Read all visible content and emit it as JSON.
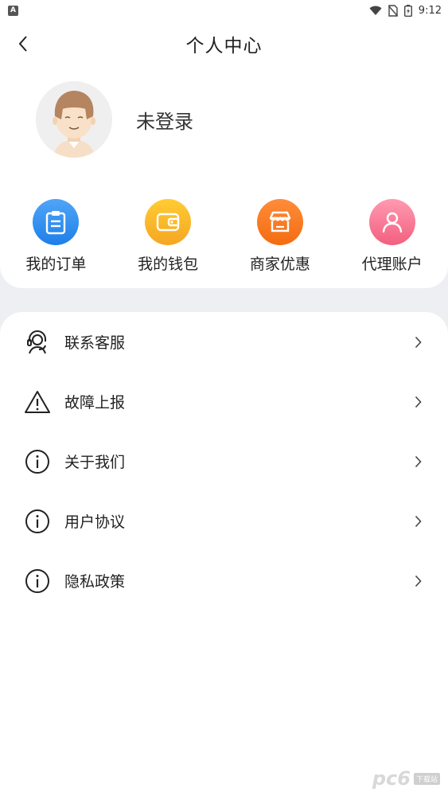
{
  "status_bar": {
    "app_badge": "A",
    "time": "9:12"
  },
  "header": {
    "title": "个人中心"
  },
  "profile": {
    "login_text": "未登录"
  },
  "quick_actions": [
    {
      "label": "我的订单",
      "icon": "clipboard-icon",
      "color": "#2e8cf0"
    },
    {
      "label": "我的钱包",
      "icon": "wallet-icon",
      "color": "#f8b62d"
    },
    {
      "label": "商家优惠",
      "icon": "store-icon",
      "color": "#f67a22"
    },
    {
      "label": "代理账户",
      "icon": "person-icon",
      "color": "#f57a94"
    }
  ],
  "menu": [
    {
      "label": "联系客服",
      "icon": "headset-icon"
    },
    {
      "label": "故障上报",
      "icon": "warning-icon"
    },
    {
      "label": "关于我们",
      "icon": "info-icon"
    },
    {
      "label": "用户协议",
      "icon": "info-icon"
    },
    {
      "label": "隐私政策",
      "icon": "info-icon"
    }
  ],
  "watermark": {
    "text": "pc6",
    "badge": "下载站"
  }
}
